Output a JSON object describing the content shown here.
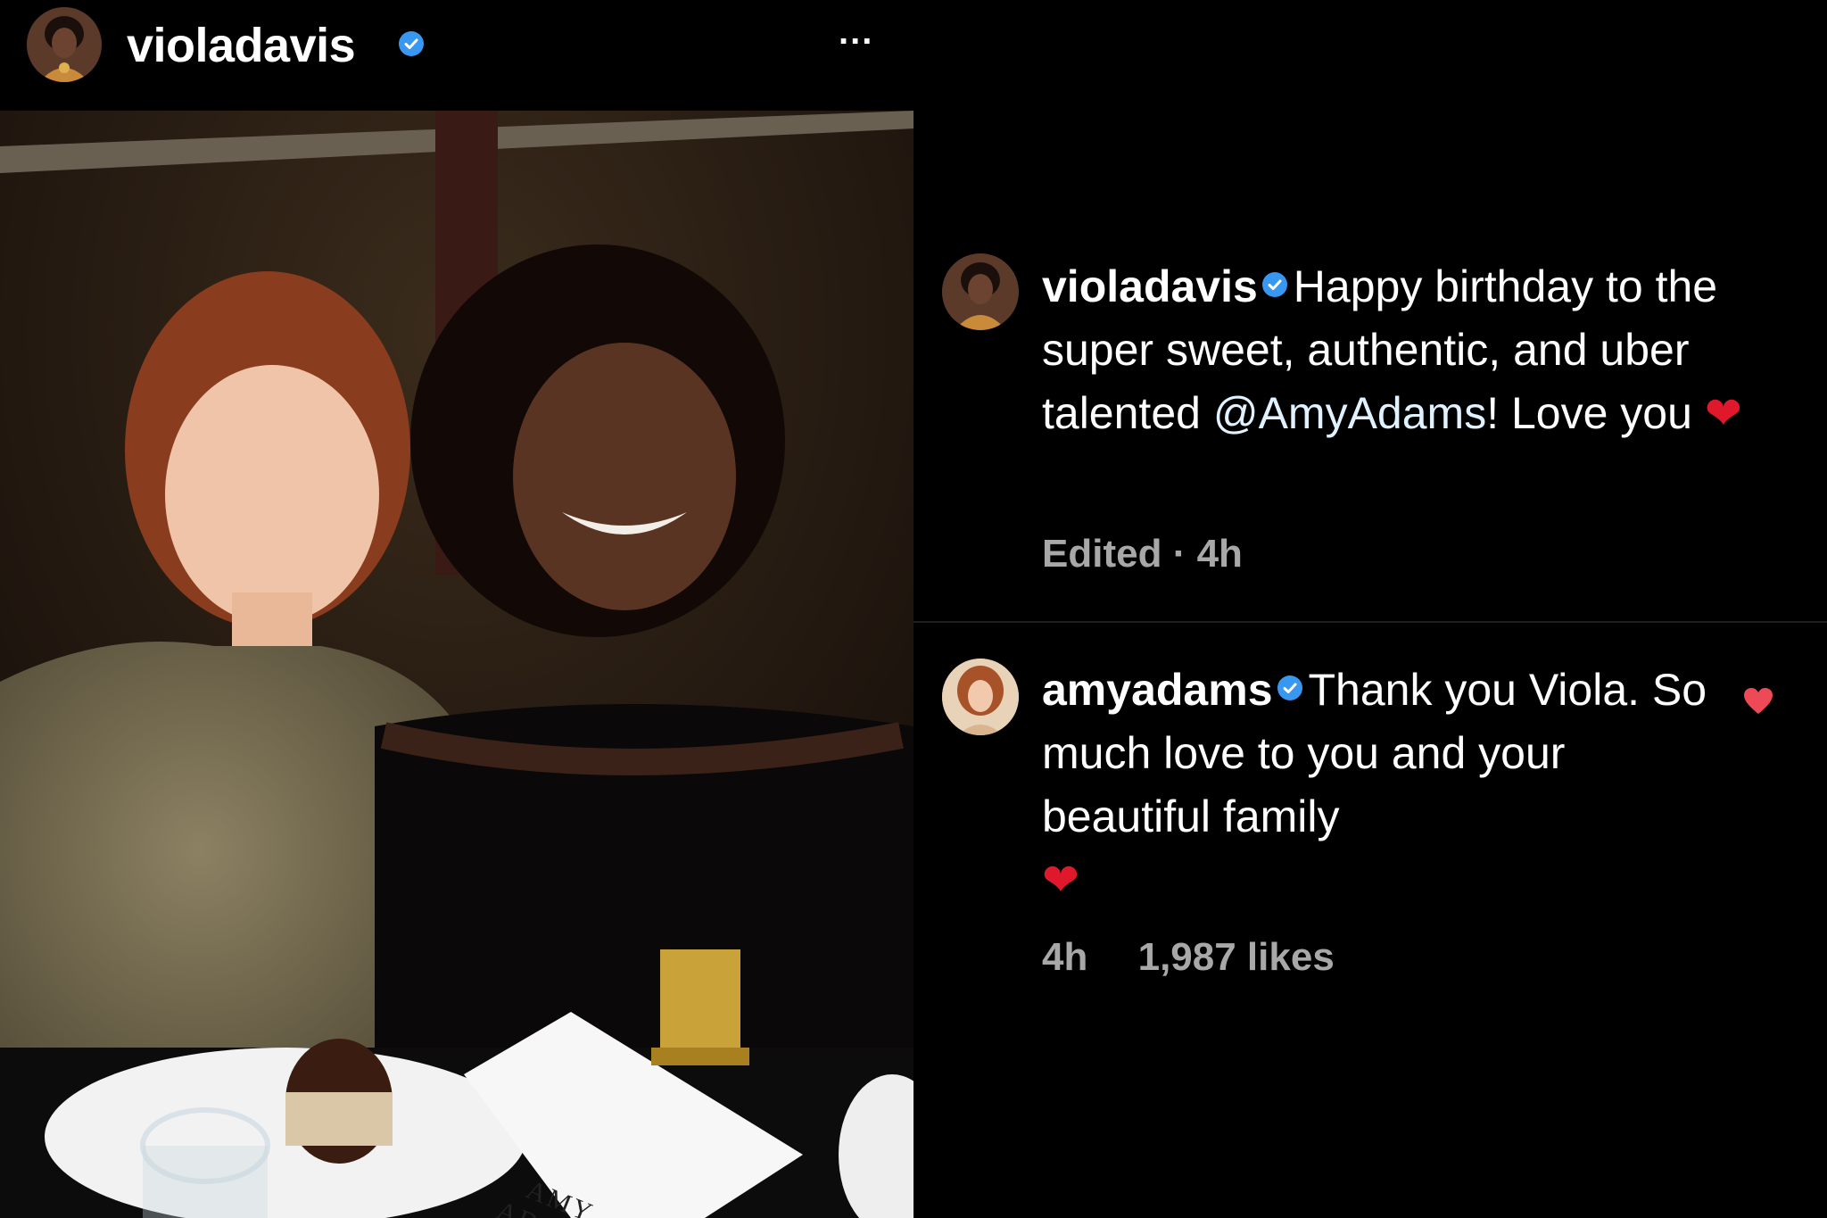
{
  "post": {
    "username": "violadavis",
    "more_label": "...",
    "photo": {
      "card_line1": "AMY",
      "card_line2": "ADAMS"
    }
  },
  "comments": [
    {
      "username": "violadavis",
      "text_before": "Happy birthday to the super sweet, authentic, and uber talented ",
      "mention": "@AmyAdams",
      "text_after": "! Love you ",
      "emoji": "❤",
      "edited_label": "Edited",
      "separator": "·",
      "time": "4h"
    },
    {
      "username": "amyadams",
      "text": "Thank you Viola. So much love to you and your beautiful family",
      "emoji": "❤",
      "time": "4h",
      "likes": "1,987 likes",
      "liked": true
    }
  ],
  "icons": {
    "verified_badge": "verified-badge-icon",
    "more": "more-options-icon",
    "like": "heart-icon"
  },
  "colors": {
    "background": "#000000",
    "verified": "#3897f0",
    "meta_text": "#a8a8a8",
    "like_red": "#ed4956"
  }
}
